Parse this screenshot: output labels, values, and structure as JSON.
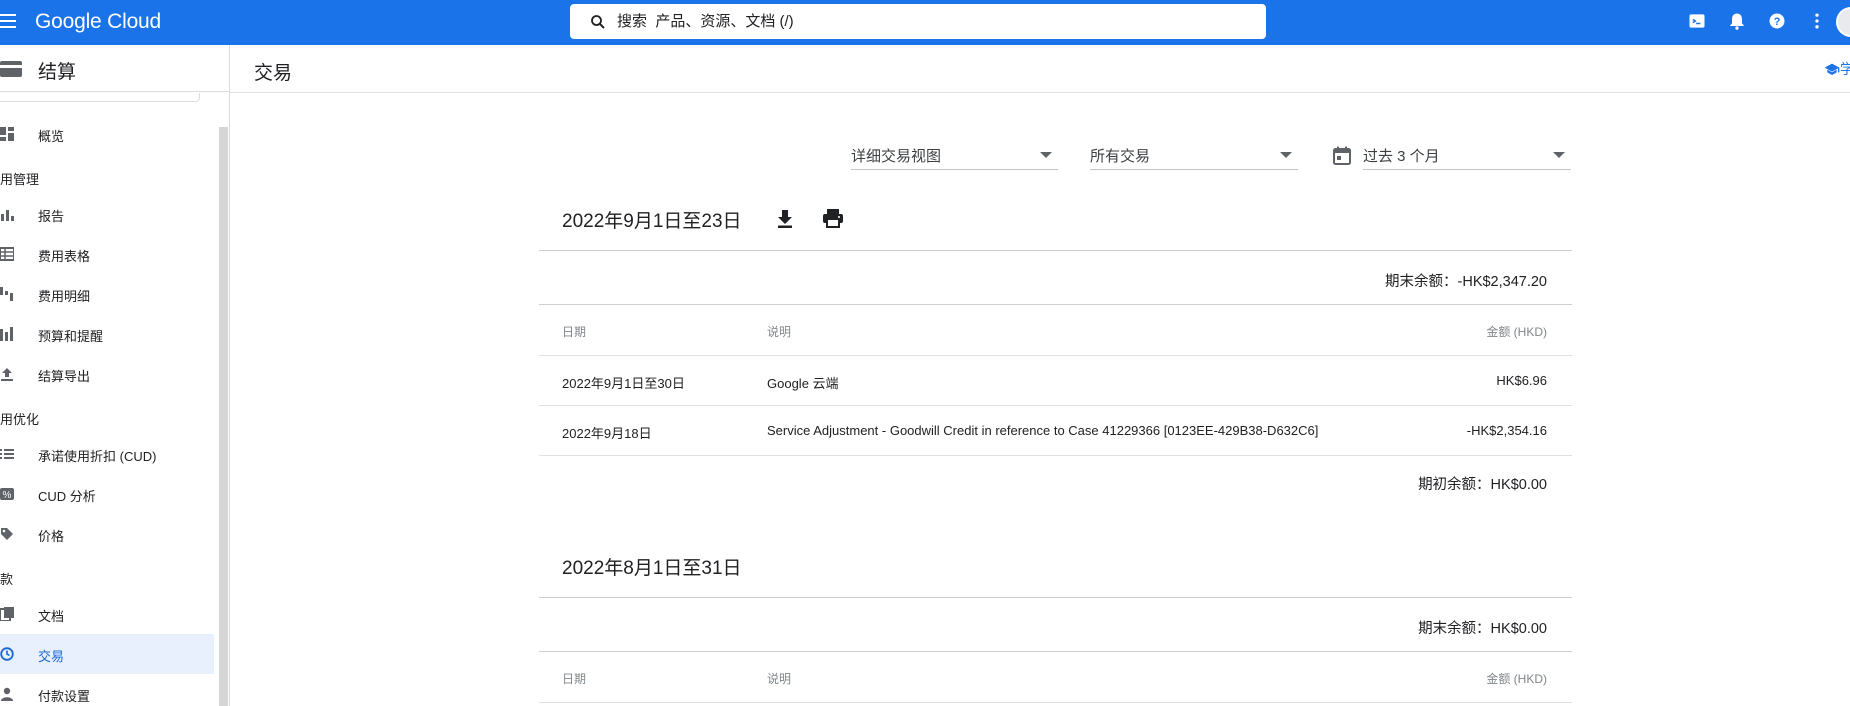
{
  "topbar": {
    "logo": "Google Cloud",
    "search_placeholder": "搜索  产品、资源、文档 (/)",
    "icons": [
      "menu-icon",
      "search-icon",
      "cloud-shell-icon",
      "notifications-icon",
      "help-icon",
      "more-vert-icon",
      "avatar"
    ]
  },
  "sidebar": {
    "title": "结算",
    "items": [
      {
        "label": "概览",
        "icon": "dashboard-icon"
      },
      {
        "section": "费用管理",
        "shown": "用管理"
      },
      {
        "label": "报告",
        "icon": "bar-chart-icon"
      },
      {
        "label": "费用表格",
        "icon": "table-icon"
      },
      {
        "label": "费用明细",
        "icon": "waterfall-icon"
      },
      {
        "label": "预算和提醒",
        "icon": "budget-icon"
      },
      {
        "label": "结算导出",
        "icon": "upload-icon"
      },
      {
        "section": "费用优化",
        "shown": "用优化"
      },
      {
        "label": "承诺使用折扣 (CUD)",
        "icon": "list-icon"
      },
      {
        "label": "CUD 分析",
        "icon": "percent-icon"
      },
      {
        "label": "价格",
        "icon": "tag-icon"
      },
      {
        "section": "付款",
        "shown": "款"
      },
      {
        "label": "文档",
        "icon": "document-icon"
      },
      {
        "label": "交易",
        "icon": "clock-icon",
        "active": true
      },
      {
        "label": "付款设置",
        "icon": "person-icon"
      }
    ]
  },
  "page": {
    "title": "交易",
    "learn_label": "学"
  },
  "filters": {
    "view": "详细交易视图",
    "type": "所有交易",
    "range": "过去 3 个月"
  },
  "periods": [
    {
      "title": "2022年9月1日至23日",
      "closing_balance": "期末余额：-HK$2,347.20",
      "headers": {
        "date": "日期",
        "desc": "说明",
        "amount": "金额 (HKD)"
      },
      "rows": [
        {
          "date": "2022年9月1日至30日",
          "desc": "Google 云端",
          "amount": "HK$6.96"
        },
        {
          "date": "2022年9月18日",
          "desc": "Service Adjustment - Goodwill Credit in reference to Case 41229366 [0123EE-429B38-D632C6]",
          "amount": "-HK$2,354.16"
        }
      ],
      "opening_balance": "期初余额：HK$0.00"
    },
    {
      "title": "2022年8月1日至31日",
      "closing_balance": "期末余额：HK$0.00",
      "headers": {
        "date": "日期",
        "desc": "说明",
        "amount": "金额 (HKD)"
      }
    }
  ],
  "colors": {
    "topbar": "#1a73e8",
    "active_bg": "#e8f0fe",
    "active_text": "#1967d2"
  }
}
